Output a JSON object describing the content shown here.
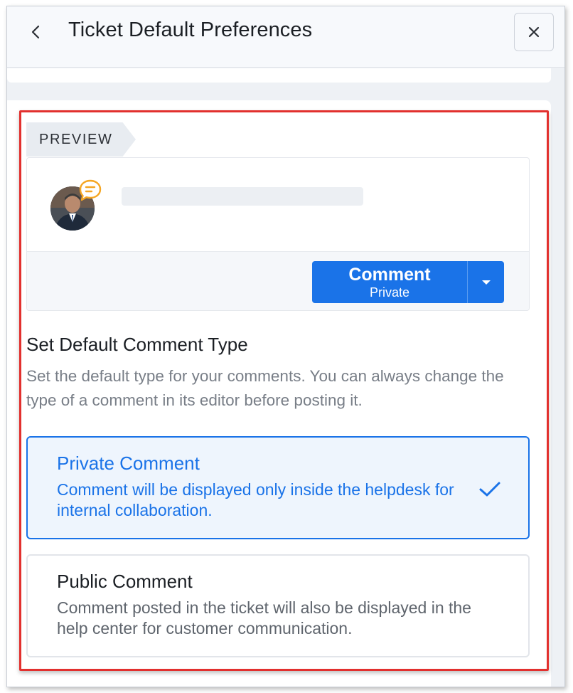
{
  "header": {
    "title": "Ticket Default Preferences"
  },
  "preview": {
    "tag": "PREVIEW",
    "comment_button": {
      "label": "Comment",
      "sublabel": "Private"
    }
  },
  "settings": {
    "title": "Set Default Comment Type",
    "description": "Set the default type for your comments. You can always change the type of a comment in its editor before posting it.",
    "options": [
      {
        "title": "Private Comment",
        "description": "Comment will be displayed only inside the helpdesk for internal collaboration.",
        "selected": true
      },
      {
        "title": "Public Comment",
        "description": "Comment posted in the ticket will also be displayed in the help center for customer communication.",
        "selected": false
      }
    ]
  },
  "colors": {
    "accent": "#1a73e8",
    "highlight_border": "#e2302e",
    "comment_icon": "#f5a623"
  },
  "icons": [
    "chevron-left-icon",
    "close-icon",
    "comment-bubble-icon",
    "caret-down-icon",
    "checkmark-icon"
  ]
}
